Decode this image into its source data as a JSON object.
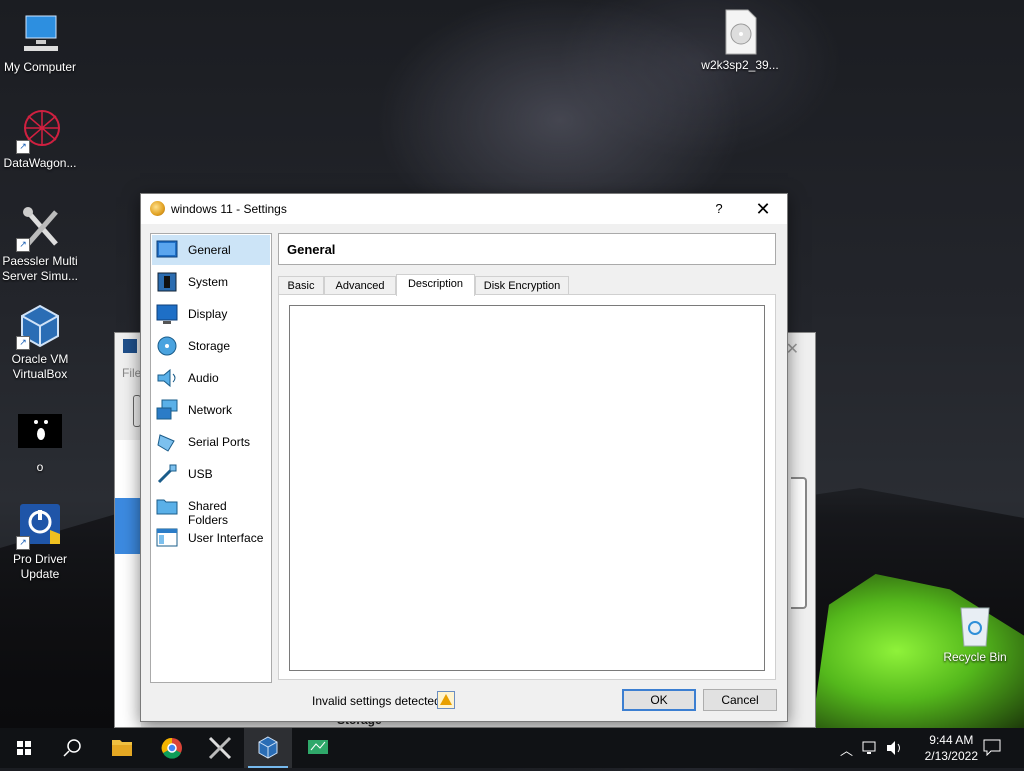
{
  "desktop": {
    "icons": [
      {
        "label": "My Computer"
      },
      {
        "label": "DataWagon..."
      },
      {
        "label": "Paessler Multi Server Simu..."
      },
      {
        "label": "Oracle VM VirtualBox"
      },
      {
        "label": "o"
      },
      {
        "label": "Pro Driver Update"
      },
      {
        "label": "w2k3sp2_39..."
      },
      {
        "label": "Recycle Bin"
      }
    ]
  },
  "background_window": {
    "menu_partial": "File",
    "section_partial": "Storage"
  },
  "dialog": {
    "title": "windows 11 - Settings",
    "help_label": "?",
    "close_label": "✕",
    "nav": [
      {
        "label": "General"
      },
      {
        "label": "System"
      },
      {
        "label": "Display"
      },
      {
        "label": "Storage"
      },
      {
        "label": "Audio"
      },
      {
        "label": "Network"
      },
      {
        "label": "Serial Ports"
      },
      {
        "label": "USB"
      },
      {
        "label": "Shared Folders"
      },
      {
        "label": "User Interface"
      }
    ],
    "selected_nav": "General",
    "section_title": "General",
    "tabs": [
      {
        "label": "Basic"
      },
      {
        "label": "Advanced"
      },
      {
        "label": "Description"
      },
      {
        "label": "Disk Encryption"
      }
    ],
    "active_tab": "Description",
    "description_value": "",
    "status_text": "Invalid settings detected",
    "ok_label": "OK",
    "cancel_label": "Cancel"
  },
  "taskbar": {
    "time": "9:44 AM",
    "date": "2/13/2022",
    "apps": [
      "start-icon",
      "search-icon",
      "file-explorer-icon",
      "chrome-icon",
      "tools-icon",
      "virtualbox-icon",
      "network-monitor-icon"
    ],
    "active_app": "virtualbox-icon"
  }
}
